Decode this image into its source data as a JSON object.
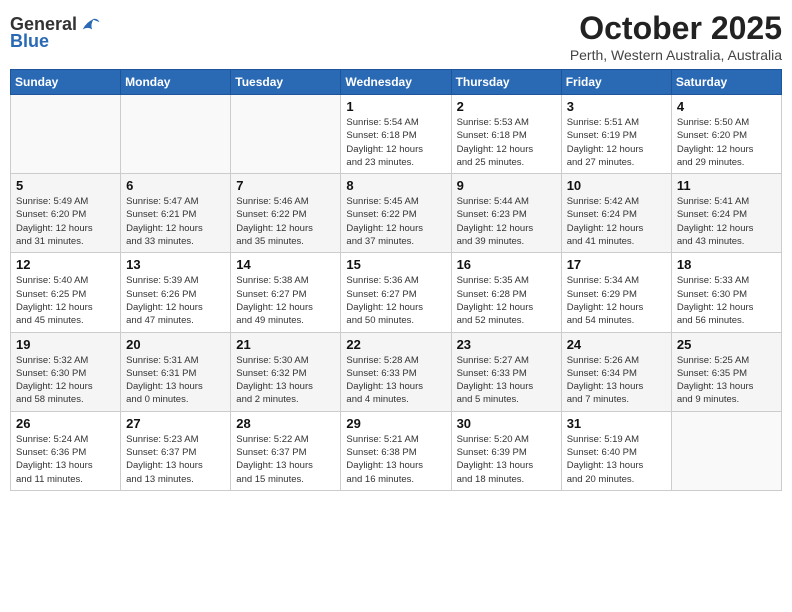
{
  "logo": {
    "general": "General",
    "blue": "Blue"
  },
  "header": {
    "title": "October 2025",
    "subtitle": "Perth, Western Australia, Australia"
  },
  "days_of_week": [
    "Sunday",
    "Monday",
    "Tuesday",
    "Wednesday",
    "Thursday",
    "Friday",
    "Saturday"
  ],
  "weeks": [
    [
      {
        "day": "",
        "info": ""
      },
      {
        "day": "",
        "info": ""
      },
      {
        "day": "",
        "info": ""
      },
      {
        "day": "1",
        "info": "Sunrise: 5:54 AM\nSunset: 6:18 PM\nDaylight: 12 hours\nand 23 minutes."
      },
      {
        "day": "2",
        "info": "Sunrise: 5:53 AM\nSunset: 6:18 PM\nDaylight: 12 hours\nand 25 minutes."
      },
      {
        "day": "3",
        "info": "Sunrise: 5:51 AM\nSunset: 6:19 PM\nDaylight: 12 hours\nand 27 minutes."
      },
      {
        "day": "4",
        "info": "Sunrise: 5:50 AM\nSunset: 6:20 PM\nDaylight: 12 hours\nand 29 minutes."
      }
    ],
    [
      {
        "day": "5",
        "info": "Sunrise: 5:49 AM\nSunset: 6:20 PM\nDaylight: 12 hours\nand 31 minutes."
      },
      {
        "day": "6",
        "info": "Sunrise: 5:47 AM\nSunset: 6:21 PM\nDaylight: 12 hours\nand 33 minutes."
      },
      {
        "day": "7",
        "info": "Sunrise: 5:46 AM\nSunset: 6:22 PM\nDaylight: 12 hours\nand 35 minutes."
      },
      {
        "day": "8",
        "info": "Sunrise: 5:45 AM\nSunset: 6:22 PM\nDaylight: 12 hours\nand 37 minutes."
      },
      {
        "day": "9",
        "info": "Sunrise: 5:44 AM\nSunset: 6:23 PM\nDaylight: 12 hours\nand 39 minutes."
      },
      {
        "day": "10",
        "info": "Sunrise: 5:42 AM\nSunset: 6:24 PM\nDaylight: 12 hours\nand 41 minutes."
      },
      {
        "day": "11",
        "info": "Sunrise: 5:41 AM\nSunset: 6:24 PM\nDaylight: 12 hours\nand 43 minutes."
      }
    ],
    [
      {
        "day": "12",
        "info": "Sunrise: 5:40 AM\nSunset: 6:25 PM\nDaylight: 12 hours\nand 45 minutes."
      },
      {
        "day": "13",
        "info": "Sunrise: 5:39 AM\nSunset: 6:26 PM\nDaylight: 12 hours\nand 47 minutes."
      },
      {
        "day": "14",
        "info": "Sunrise: 5:38 AM\nSunset: 6:27 PM\nDaylight: 12 hours\nand 49 minutes."
      },
      {
        "day": "15",
        "info": "Sunrise: 5:36 AM\nSunset: 6:27 PM\nDaylight: 12 hours\nand 50 minutes."
      },
      {
        "day": "16",
        "info": "Sunrise: 5:35 AM\nSunset: 6:28 PM\nDaylight: 12 hours\nand 52 minutes."
      },
      {
        "day": "17",
        "info": "Sunrise: 5:34 AM\nSunset: 6:29 PM\nDaylight: 12 hours\nand 54 minutes."
      },
      {
        "day": "18",
        "info": "Sunrise: 5:33 AM\nSunset: 6:30 PM\nDaylight: 12 hours\nand 56 minutes."
      }
    ],
    [
      {
        "day": "19",
        "info": "Sunrise: 5:32 AM\nSunset: 6:30 PM\nDaylight: 12 hours\nand 58 minutes."
      },
      {
        "day": "20",
        "info": "Sunrise: 5:31 AM\nSunset: 6:31 PM\nDaylight: 13 hours\nand 0 minutes."
      },
      {
        "day": "21",
        "info": "Sunrise: 5:30 AM\nSunset: 6:32 PM\nDaylight: 13 hours\nand 2 minutes."
      },
      {
        "day": "22",
        "info": "Sunrise: 5:28 AM\nSunset: 6:33 PM\nDaylight: 13 hours\nand 4 minutes."
      },
      {
        "day": "23",
        "info": "Sunrise: 5:27 AM\nSunset: 6:33 PM\nDaylight: 13 hours\nand 5 minutes."
      },
      {
        "day": "24",
        "info": "Sunrise: 5:26 AM\nSunset: 6:34 PM\nDaylight: 13 hours\nand 7 minutes."
      },
      {
        "day": "25",
        "info": "Sunrise: 5:25 AM\nSunset: 6:35 PM\nDaylight: 13 hours\nand 9 minutes."
      }
    ],
    [
      {
        "day": "26",
        "info": "Sunrise: 5:24 AM\nSunset: 6:36 PM\nDaylight: 13 hours\nand 11 minutes."
      },
      {
        "day": "27",
        "info": "Sunrise: 5:23 AM\nSunset: 6:37 PM\nDaylight: 13 hours\nand 13 minutes."
      },
      {
        "day": "28",
        "info": "Sunrise: 5:22 AM\nSunset: 6:37 PM\nDaylight: 13 hours\nand 15 minutes."
      },
      {
        "day": "29",
        "info": "Sunrise: 5:21 AM\nSunset: 6:38 PM\nDaylight: 13 hours\nand 16 minutes."
      },
      {
        "day": "30",
        "info": "Sunrise: 5:20 AM\nSunset: 6:39 PM\nDaylight: 13 hours\nand 18 minutes."
      },
      {
        "day": "31",
        "info": "Sunrise: 5:19 AM\nSunset: 6:40 PM\nDaylight: 13 hours\nand 20 minutes."
      },
      {
        "day": "",
        "info": ""
      }
    ]
  ]
}
